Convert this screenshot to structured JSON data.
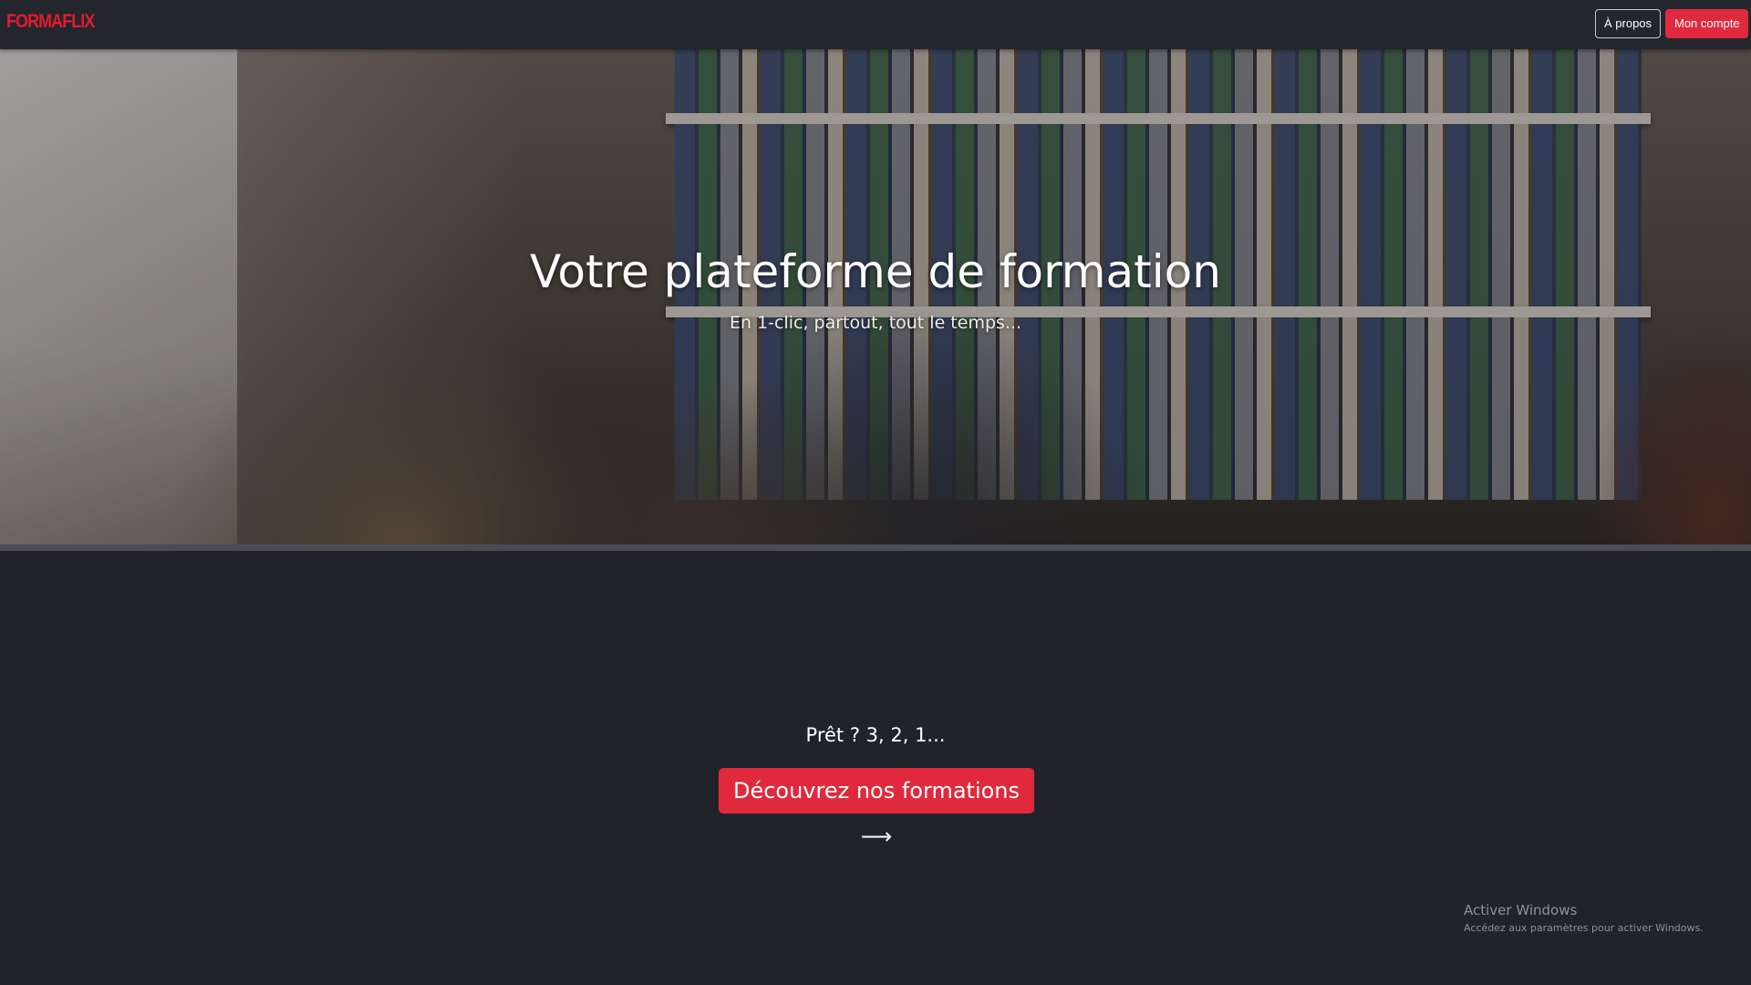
{
  "navbar": {
    "logo": "FORMAFLIX",
    "about_label": "À propos",
    "account_label": "Mon compte"
  },
  "hero": {
    "title": "Votre plateforme de formation",
    "subtitle": "En 1-clic, partout, tout le temps..."
  },
  "main": {
    "ready_text": "Prêt ? 3, 2, 1...",
    "cta_label": "Découvrez nos formations ⟶"
  },
  "watermark": {
    "title": "Activer Windows",
    "subtitle": "Accédez aux paramètres pour activer Windows."
  },
  "colors": {
    "brand_red": "#e0293c",
    "background": "#20232a",
    "navbar": "#23262d"
  }
}
